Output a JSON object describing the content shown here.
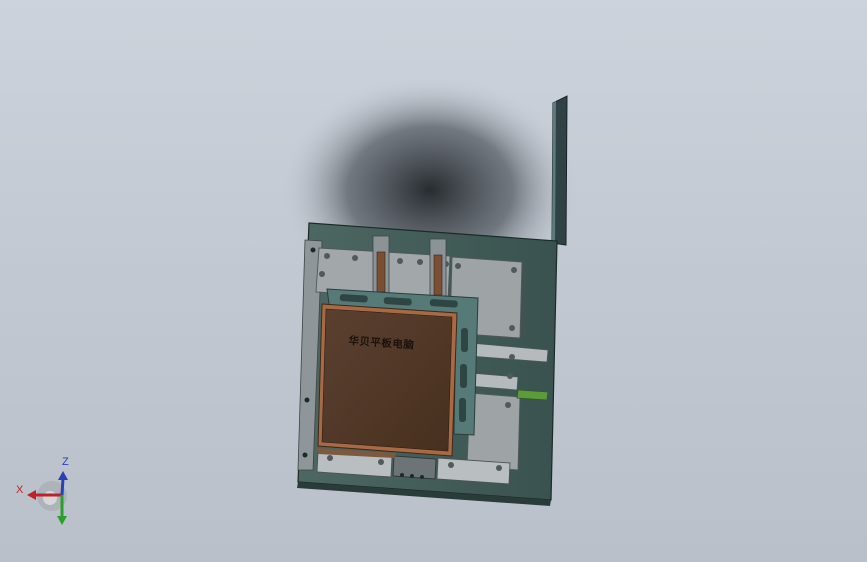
{
  "viewport": {
    "background_top": "#cdd3dc",
    "background_bottom": "#b9c0ca"
  },
  "model": {
    "part_label": "华贝平板电脑",
    "colors": {
      "base_plate": "#3e5a55",
      "clamp_block": "#9aa0a4",
      "tablet_body": "#4e3628",
      "tablet_border": "#a86a44",
      "bracket": "#557a78",
      "vertical_plate": "#2f4245",
      "green_rail": "#5d9a3c"
    }
  },
  "triad": {
    "x_label": "X",
    "z_label": "Z",
    "icons": [
      "triad-x-arrow-icon",
      "triad-y-arrow-icon",
      "triad-z-arrow-icon"
    ],
    "colors": {
      "x": "#c0202a",
      "y": "#2aa02a",
      "z": "#2a3fb8"
    }
  }
}
